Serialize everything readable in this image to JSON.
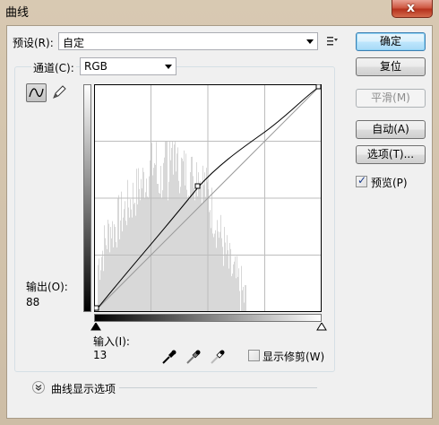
{
  "window": {
    "title": "曲线",
    "close_glyph": "x"
  },
  "preset": {
    "label": "预设(R):",
    "value": "自定"
  },
  "channel": {
    "label": "通道(C):",
    "value": "RGB"
  },
  "buttons": {
    "ok": "确定",
    "reset": "复位",
    "smooth": "平滑(M)",
    "auto": "自动(A)",
    "options": "选项(T)..."
  },
  "preview": {
    "label": "预览(P)",
    "checked": true
  },
  "output": {
    "label": "输出(O):",
    "value": "88"
  },
  "input": {
    "label": "输入(I):",
    "value": "13"
  },
  "show_clipping": {
    "label": "显示修剪(W)",
    "checked": false
  },
  "curve_display_options": {
    "label": "曲线显示选项"
  },
  "icons": {
    "preset_menu": "preset-menu-icon",
    "curve_tool": "curve-point-tool-icon",
    "pencil_tool": "pencil-tool-icon",
    "black_eyedropper": "black-eyedropper-icon",
    "gray_eyedropper": "gray-eyedropper-icon",
    "white_eyedropper": "white-eyedropper-icon",
    "expand": "chevron-down-icon"
  },
  "colors": {
    "default_button_border": "#3c7fb1",
    "histogram_fill": "#d8d8d8",
    "curve_line": "#000000",
    "titlebar_close": "#c8402b"
  }
}
